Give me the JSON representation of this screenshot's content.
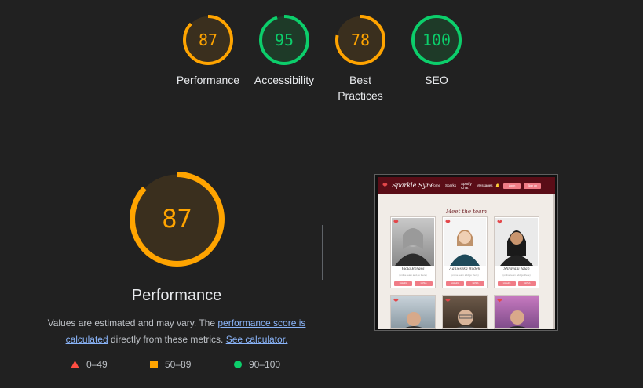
{
  "categories": [
    {
      "score": 87,
      "label": "Performance",
      "color": "#ffa400",
      "track": "#3a2f1e"
    },
    {
      "score": 95,
      "label": "Accessibility",
      "color": "#0cce6b",
      "track": "#1e3a28"
    },
    {
      "score": 78,
      "label": "Best Practices",
      "color": "#ffa400",
      "track": "#3a2f1e"
    },
    {
      "score": 100,
      "label": "SEO",
      "color": "#0cce6b",
      "track": "#1e3a28"
    }
  ],
  "main": {
    "score": 87,
    "title": "Performance",
    "color": "#ffa400",
    "desc_prefix": "Values are estimated and may vary. The ",
    "link_score": "performance score is calculated",
    "desc_middle": " directly from these metrics. ",
    "link_calc": "See calculator."
  },
  "legend": [
    {
      "shape": "triangle",
      "range": "0–49",
      "color": "#ff4e42"
    },
    {
      "shape": "square",
      "range": "50–89",
      "color": "#ffa400"
    },
    {
      "shape": "circle",
      "range": "90–100",
      "color": "#0cce6b"
    }
  ],
  "thumbnail": {
    "logo": "Sparkle Sync",
    "menu": [
      "Home",
      "Sparks",
      "Spotify Chat",
      "Messages"
    ],
    "buttons": [
      "Login",
      "Sign up"
    ],
    "heading": "Meet the team",
    "members": [
      {
        "name": "Viola Borges",
        "sub": "(online team add go there)",
        "btn1": "LinkedIn",
        "btn2": "GitHub"
      },
      {
        "name": "Agnieszka Budek",
        "sub": "(online team add go there)",
        "btn1": "LinkedIn",
        "btn2": "GitHub"
      },
      {
        "name": "Shravani Jalan",
        "sub": "(online team add go there)",
        "btn1": "LinkedIn",
        "btn2": "GitHub"
      }
    ]
  }
}
